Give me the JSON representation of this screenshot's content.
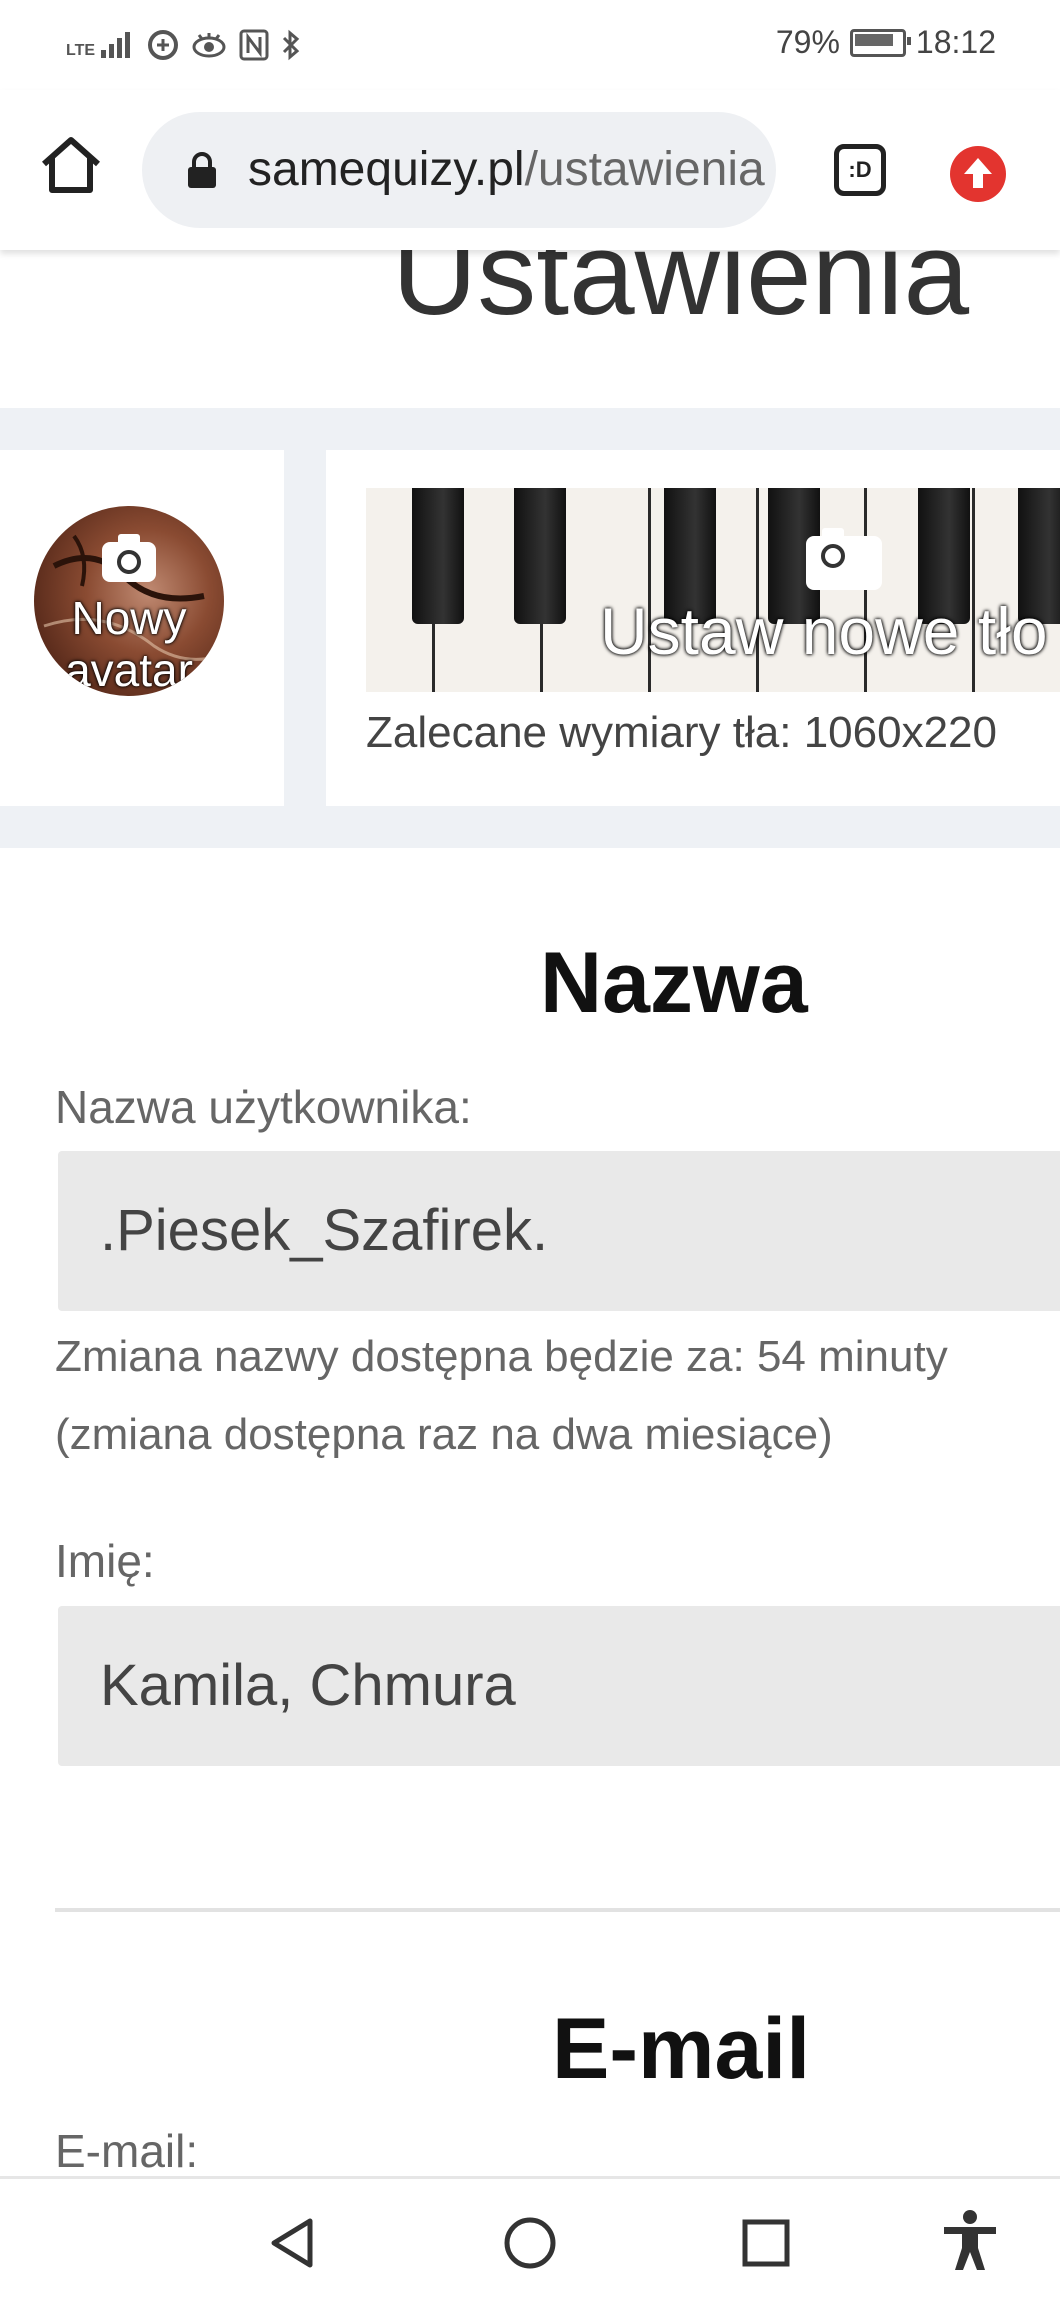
{
  "status_bar": {
    "network": "LTE",
    "battery": "79%",
    "time": "18:12"
  },
  "browser": {
    "url_domain": "samequizy.pl",
    "url_path": "/ustawienia",
    "tab_label": ":D"
  },
  "page": {
    "title": "Ustawienia",
    "avatar_label_line1": "Nowy",
    "avatar_label_line2": "avatar",
    "banner_label": "Ustaw nowe tło",
    "banner_dims": "Zalecane wymiary tła: 1060x220",
    "name_section": {
      "heading": "Nazwa",
      "username_label": "Nazwa użytkownika:",
      "username_value": ".Piesek_Szafirek.",
      "change_note": "Zmiana nazwy dostępna będzie za: 54 minuty",
      "change_note2": "(zmiana dostępna raz na dwa miesiące)",
      "first_name_label": "Imię:",
      "first_name_value": "Kamila, Chmura"
    },
    "email_section": {
      "heading": "E-mail",
      "email_label": "E-mail:"
    }
  },
  "colors": {
    "update_button": "#e3342f",
    "band": "#eef1f5",
    "field_bg": "#e9e9e9"
  }
}
